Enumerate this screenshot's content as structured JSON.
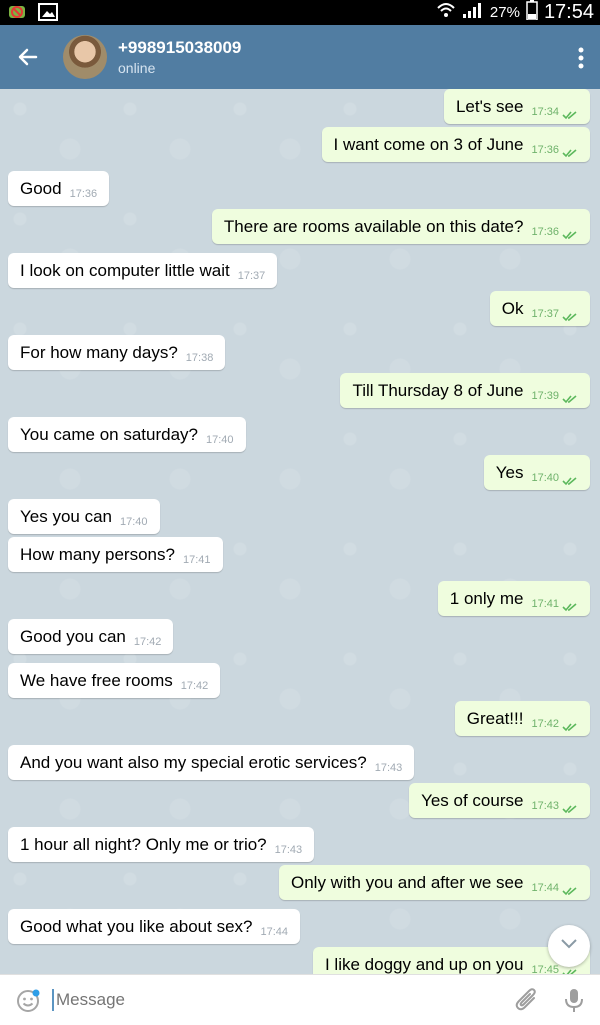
{
  "status_bar": {
    "battery_percent": "27%",
    "time": "17:54",
    "notification_icons": [
      "android-debug-icon",
      "gallery-icon"
    ],
    "system_icons": [
      "wifi-icon",
      "signal-icon",
      "battery-icon"
    ]
  },
  "header": {
    "contact_name": "+998915038009",
    "contact_status": "online",
    "icons": [
      "back-arrow-icon",
      "avatar",
      "more-vert-icon"
    ]
  },
  "messages": [
    {
      "dir": "out",
      "text": "Let's see",
      "time": "17:34",
      "read": true
    },
    {
      "dir": "out",
      "text": "I want come on 3 of June",
      "time": "17:36",
      "read": true
    },
    {
      "dir": "in",
      "text": "Good",
      "time": "17:36"
    },
    {
      "dir": "out",
      "text": "There are rooms available on this date?",
      "time": "17:36",
      "read": true
    },
    {
      "dir": "in",
      "text": "I look on computer little wait",
      "time": "17:37"
    },
    {
      "dir": "out",
      "text": "Ok",
      "time": "17:37",
      "read": true
    },
    {
      "dir": "in",
      "text": "For how many days?",
      "time": "17:38"
    },
    {
      "dir": "out",
      "text": "Till Thursday 8 of June",
      "time": "17:39",
      "read": true
    },
    {
      "dir": "in",
      "text": "You came on saturday?",
      "time": "17:40"
    },
    {
      "dir": "out",
      "text": "Yes",
      "time": "17:40",
      "read": true
    },
    {
      "dir": "in",
      "text": "Yes you can",
      "time": "17:40"
    },
    {
      "dir": "in",
      "text": "How many persons?",
      "time": "17:41"
    },
    {
      "dir": "out",
      "text": "1 only me",
      "time": "17:41",
      "read": true
    },
    {
      "dir": "in",
      "text": "Good you can",
      "time": "17:42"
    },
    {
      "dir": "in",
      "text": "We have free rooms",
      "time": "17:42"
    },
    {
      "dir": "out",
      "text": "Great!!!",
      "time": "17:42",
      "read": true
    },
    {
      "dir": "in",
      "text": "And you want also my special erotic services?",
      "time": "17:43"
    },
    {
      "dir": "out",
      "text": "Yes of course",
      "time": "17:43",
      "read": true
    },
    {
      "dir": "in",
      "text": "1 hour all night? Only me or trio?",
      "time": "17:43"
    },
    {
      "dir": "out",
      "text": "Only with you and after we see",
      "time": "17:44",
      "read": true
    },
    {
      "dir": "in",
      "text": "Good what you like about sex?",
      "time": "17:44"
    },
    {
      "dir": "out",
      "text": "I like doggy and up on you",
      "time": "17:45",
      "read": true
    }
  ],
  "input": {
    "placeholder": "Message",
    "icons": [
      "emoji-icon",
      "attach-icon",
      "microphone-icon"
    ]
  },
  "colors": {
    "header_bg": "#517da2",
    "incoming_bubble": "#ffffff",
    "outgoing_bubble": "#effdde",
    "read_check": "#6fb26b",
    "chat_bg": "#cbd7de"
  }
}
